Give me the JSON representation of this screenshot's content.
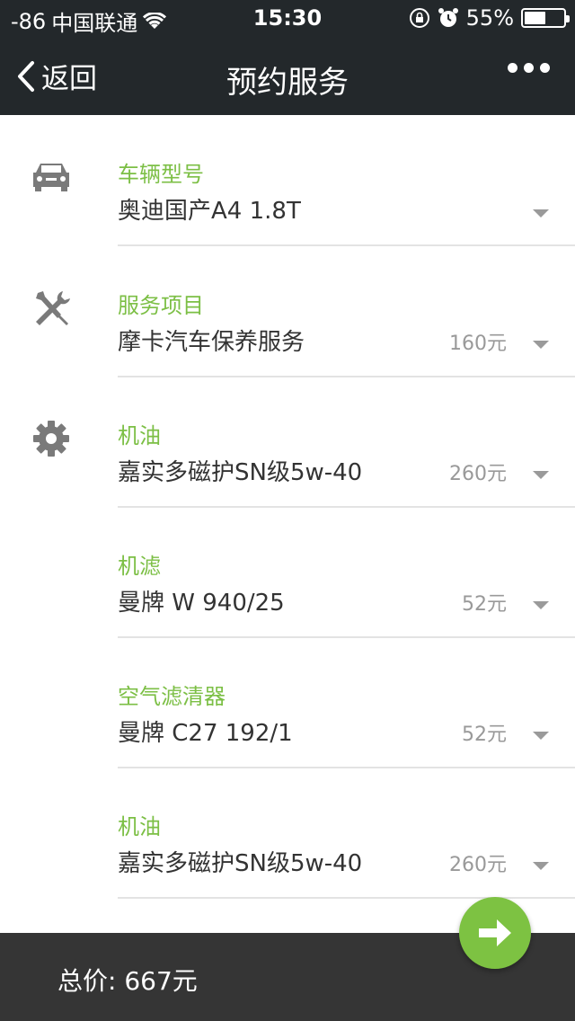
{
  "status_bar": {
    "signal": "-86",
    "carrier": "中国联通",
    "time": "15:30",
    "battery_percent": "55%",
    "battery_level": 0.55
  },
  "nav": {
    "back_label": "返回",
    "title": "预约服务"
  },
  "items": [
    {
      "icon": "car-icon",
      "label": "车辆型号",
      "value": "奥迪国产A4 1.8T",
      "price": ""
    },
    {
      "icon": "tools-icon",
      "label": "服务项目",
      "value": "摩卡汽车保养服务",
      "price": "160元"
    },
    {
      "icon": "gear-icon",
      "label": "机油",
      "value": "嘉实多磁护SN级5w-40",
      "price": "260元"
    },
    {
      "icon": "",
      "label": "机滤",
      "value": "曼牌 W 940/25",
      "price": "52元"
    },
    {
      "icon": "",
      "label": "空气滤清器",
      "value": "曼牌 C27 192/1",
      "price": "52元"
    },
    {
      "icon": "",
      "label": "机油",
      "value": "嘉实多磁护SN级5w-40",
      "price": "260元"
    }
  ],
  "footer": {
    "total_label": "总价: 667元"
  },
  "colors": {
    "accent_green": "#7cbf45",
    "header_bg": "#23282b",
    "footer_bg": "#353535"
  }
}
